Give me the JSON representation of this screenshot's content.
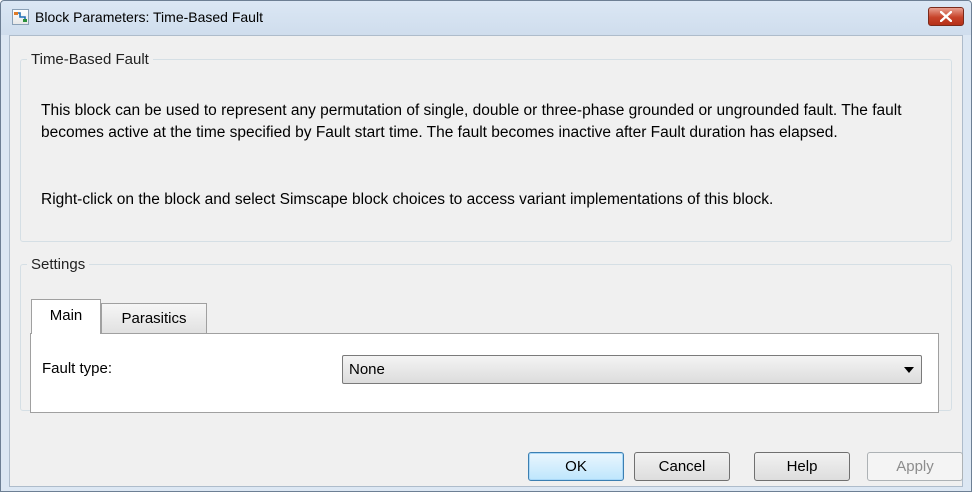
{
  "window": {
    "title": "Block Parameters: Time-Based Fault",
    "icon": "simulink-block-icon",
    "close_icon": "close-icon"
  },
  "description_group": {
    "title": "Time-Based Fault",
    "paragraph1": "This block can be used to represent any permutation of single, double or three-phase grounded or ungrounded fault. The fault becomes active at the time specified by Fault start time. The fault becomes inactive after Fault duration has elapsed.",
    "paragraph2": "Right-click on the block and select Simscape block choices to access variant implementations of this block."
  },
  "settings_group": {
    "title": "Settings",
    "tabs": [
      {
        "label": "Main",
        "active": true
      },
      {
        "label": "Parasitics",
        "active": false
      }
    ],
    "fault_type": {
      "label": "Fault type:",
      "value": "None",
      "arrow_icon": "dropdown-arrow-icon"
    }
  },
  "buttons": {
    "ok": "OK",
    "cancel": "Cancel",
    "help": "Help",
    "apply": "Apply"
  }
}
